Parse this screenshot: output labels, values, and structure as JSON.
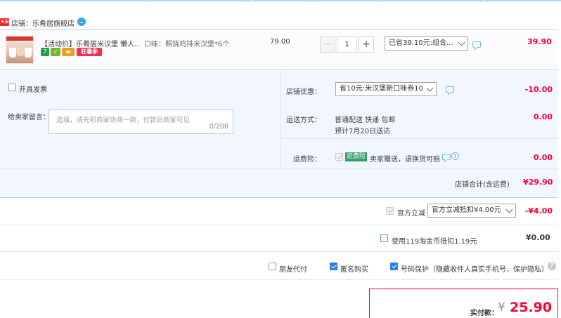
{
  "shop": {
    "badge": "天猫",
    "label": "店铺：乐肴居旗舰店",
    "wangwang_count": "1"
  },
  "item": {
    "title": "【活动价】乐肴居米汉堡 懒人...",
    "badges": [
      "7",
      "",
      "",
      "狂暑季"
    ],
    "attribute": "口味：照烧鸡排米汉堡*6个",
    "unit_price": "79.00",
    "quantity": "1",
    "discount_select": "已省39.10元:组合...",
    "total": "39.90"
  },
  "invoice": {
    "label": "开具发票"
  },
  "message": {
    "label": "给卖家留言：",
    "placeholder": "选填，请先和商家协商一致，付款后商家可见",
    "counter": "0/200"
  },
  "shop_discount": {
    "label": "店铺优惠：",
    "selected": "省10元:米汉堡新口味券10",
    "amount": "-10.00"
  },
  "shipping": {
    "label": "运送方式：",
    "line1": "普通配送 快递 包邮",
    "line2": "预计7月20日送达",
    "amount": "0.00"
  },
  "insurance": {
    "label": "运费险：",
    "tag": "运费险",
    "text": "卖家赠送，退换货可赔",
    "amount": "0.00"
  },
  "subtotal": {
    "label": "店铺合计(含运费)",
    "amount": "¥29.90"
  },
  "gov_discount": {
    "label": "官方立减",
    "selected": "官方立减抵扣¥4.00元",
    "amount": "-¥4.00"
  },
  "coins": {
    "label": "使用119淘金币抵扣1.19元",
    "amount": "¥0.00"
  },
  "options": [
    {
      "label": "朋友代付",
      "checked": false
    },
    {
      "label": "匿名购买",
      "checked": true
    },
    {
      "label": "号码保护（隐藏收件人真实手机号，保护隐私）",
      "checked": true
    }
  ],
  "payment": {
    "label": "实付款：",
    "currency": "¥",
    "amount": "25.90"
  },
  "colors": {
    "accent_red": "#ff0036",
    "panel_blue": "#f2f7ff",
    "border_blue": "#b2d1ff",
    "checkbox_blue": "#2b7de9"
  }
}
